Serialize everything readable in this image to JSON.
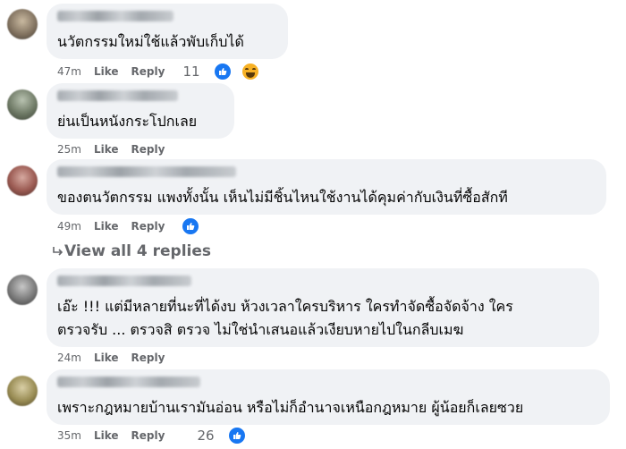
{
  "colors": {
    "bubble": "#f0f2f5",
    "meta": "#65676b",
    "like": "#1877f2",
    "haha": "#f7b125"
  },
  "comments": [
    {
      "text_lines": [
        "นวัตกรรมใหม่ใช้แล้วพับเก็บได้"
      ],
      "time": "47m",
      "like": "Like",
      "reply": "Reply",
      "reaction_count": "11",
      "reactions": [
        "like-icon",
        "haha-icon"
      ]
    },
    {
      "text_lines": [
        "ย่นเป็นหนังกระโปกเลย"
      ],
      "time": "25m",
      "like": "Like",
      "reply": "Reply"
    },
    {
      "text_lines": [
        "ของตนวัตกรรม แพงทั้งนั้น เห็นไม่มีชิ้นไหนใช้งานได้คุมค่ากับเงินที่ซื้อสักที"
      ],
      "time": "49m",
      "like": "Like",
      "reply": "Reply",
      "reactions": [
        "like-icon"
      ]
    },
    {
      "text_lines": [
        "เอ๊ะ !!! แต่มีหลายที่นะที่ได้งบ ห้วงเวลาใครบริหาร ใครทำจัดซื้อจัดจ้าง ใคร",
        "ตรวจรับ ... ตรวจสิ ตรวจ ไม่ใช่นำเสนอแล้วเงียบหายไปในกลีบเมฆ"
      ],
      "time": "24m",
      "like": "Like",
      "reply": "Reply"
    },
    {
      "text_lines": [
        "เพราะกฎหมายบ้านเรามันอ่อน หรือไม่ก็อำนาจเหนือกฎหมาย ผู้น้อยก็เลยซวย"
      ],
      "time": "35m",
      "like": "Like",
      "reply": "Reply",
      "reaction_count": "26",
      "reactions": [
        "like-icon"
      ]
    }
  ],
  "view_replies": "View all 4 replies"
}
